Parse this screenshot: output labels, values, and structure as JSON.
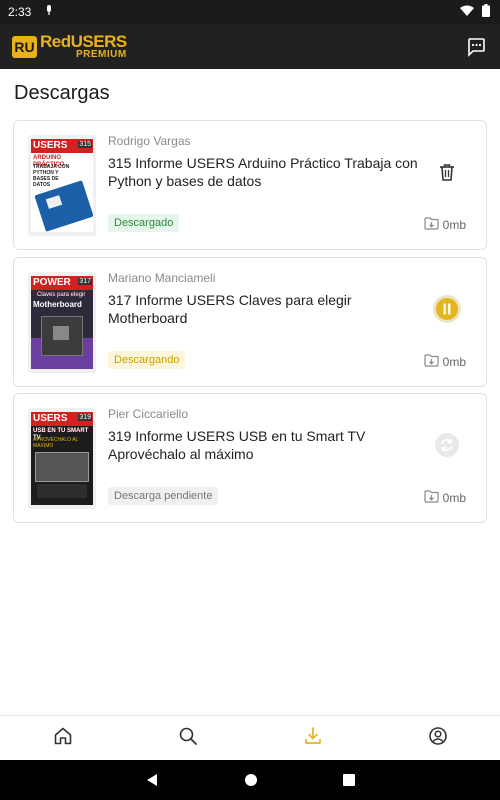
{
  "status_bar": {
    "time": "2:33"
  },
  "app_bar": {
    "logo_badge": "RU",
    "logo_text": "RedUSERS",
    "logo_subtext": "PREMIUM",
    "chat_icon": "chat-bubble-icon"
  },
  "page": {
    "title": "Descargas"
  },
  "downloads": [
    {
      "author": "Rodrigo Vargas",
      "title": "315 Informe USERS Arduino Práctico Trabaja con Python y bases de datos",
      "status": "Descargado",
      "size": "0mb",
      "action_icon": "trash-icon",
      "cover": {
        "brand": "USERS",
        "issue": "315",
        "headline": "ARDUINO PRÁCTICO",
        "sub": "TRABAJA CON PYTHON Y BASES DE DATOS"
      }
    },
    {
      "author": "Mariano Manciameli",
      "title": "317 Informe USERS Claves para elegir Motherboard",
      "status": "Descargando",
      "size": "0mb",
      "action_icon": "pause-icon",
      "cover": {
        "brand": "POWER",
        "issue": "317",
        "headline": "Claves para elegir",
        "sub": "Motherboard"
      }
    },
    {
      "author": "Pier Ciccariello",
      "title": "319 Informe USERS USB en tu Smart TV Aprovéchalo al máximo",
      "status": "Descarga pendiente",
      "size": "0mb",
      "action_icon": "sync-icon",
      "cover": {
        "brand": "USERS",
        "issue": "319",
        "headline": "USB EN TU SMART TV",
        "sub": "APROVÉCHALO AL MÁXIMO"
      }
    }
  ],
  "bottom_nav": [
    {
      "name": "home",
      "icon": "home-icon"
    },
    {
      "name": "search",
      "icon": "search-icon"
    },
    {
      "name": "downloads",
      "icon": "download-icon",
      "active": true
    },
    {
      "name": "profile",
      "icon": "profile-icon"
    }
  ],
  "colors": {
    "accent": "#e8b31a",
    "appbar": "#212121",
    "success": "#2b8a3e"
  }
}
